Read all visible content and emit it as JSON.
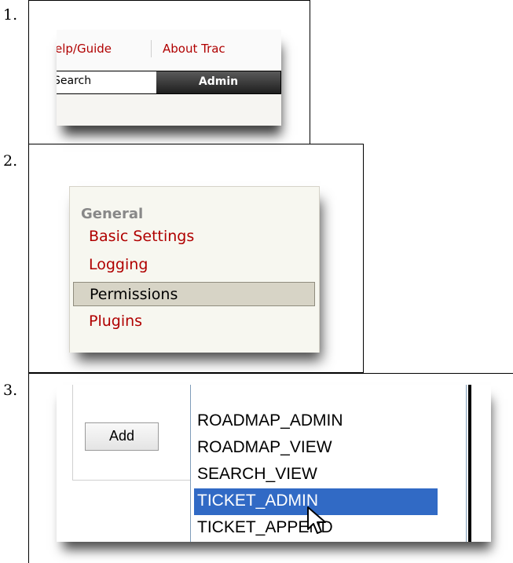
{
  "steps": [
    "1.",
    "2.",
    "3."
  ],
  "panel1": {
    "nav_links": [
      "elp/Guide",
      "About Trac"
    ],
    "tabs": {
      "search_label": "Search",
      "admin_label": "Admin"
    }
  },
  "panel2": {
    "section_heading": "General",
    "items": [
      {
        "label": "Basic Settings",
        "active": false
      },
      {
        "label": "Logging",
        "active": false
      },
      {
        "label": "Permissions",
        "active": true
      },
      {
        "label": "Plugins",
        "active": false
      }
    ]
  },
  "panel3": {
    "add_button_label": "Add",
    "permission_options": [
      {
        "label": "ROADMAP_ADMIN",
        "selected": false
      },
      {
        "label": "ROADMAP_VIEW",
        "selected": false
      },
      {
        "label": "SEARCH_VIEW",
        "selected": false
      },
      {
        "label": "TICKET_ADMIN",
        "selected": true
      },
      {
        "label": "TICKET_APPEND",
        "selected": false
      }
    ]
  },
  "colors": {
    "link_red": "#b00000",
    "selection_blue": "#316ac5",
    "active_nav_bg": "#d7d4c6",
    "admin_tab_dark": "#1e1e1e"
  },
  "icons": [
    "mouse-pointer-icon"
  ]
}
